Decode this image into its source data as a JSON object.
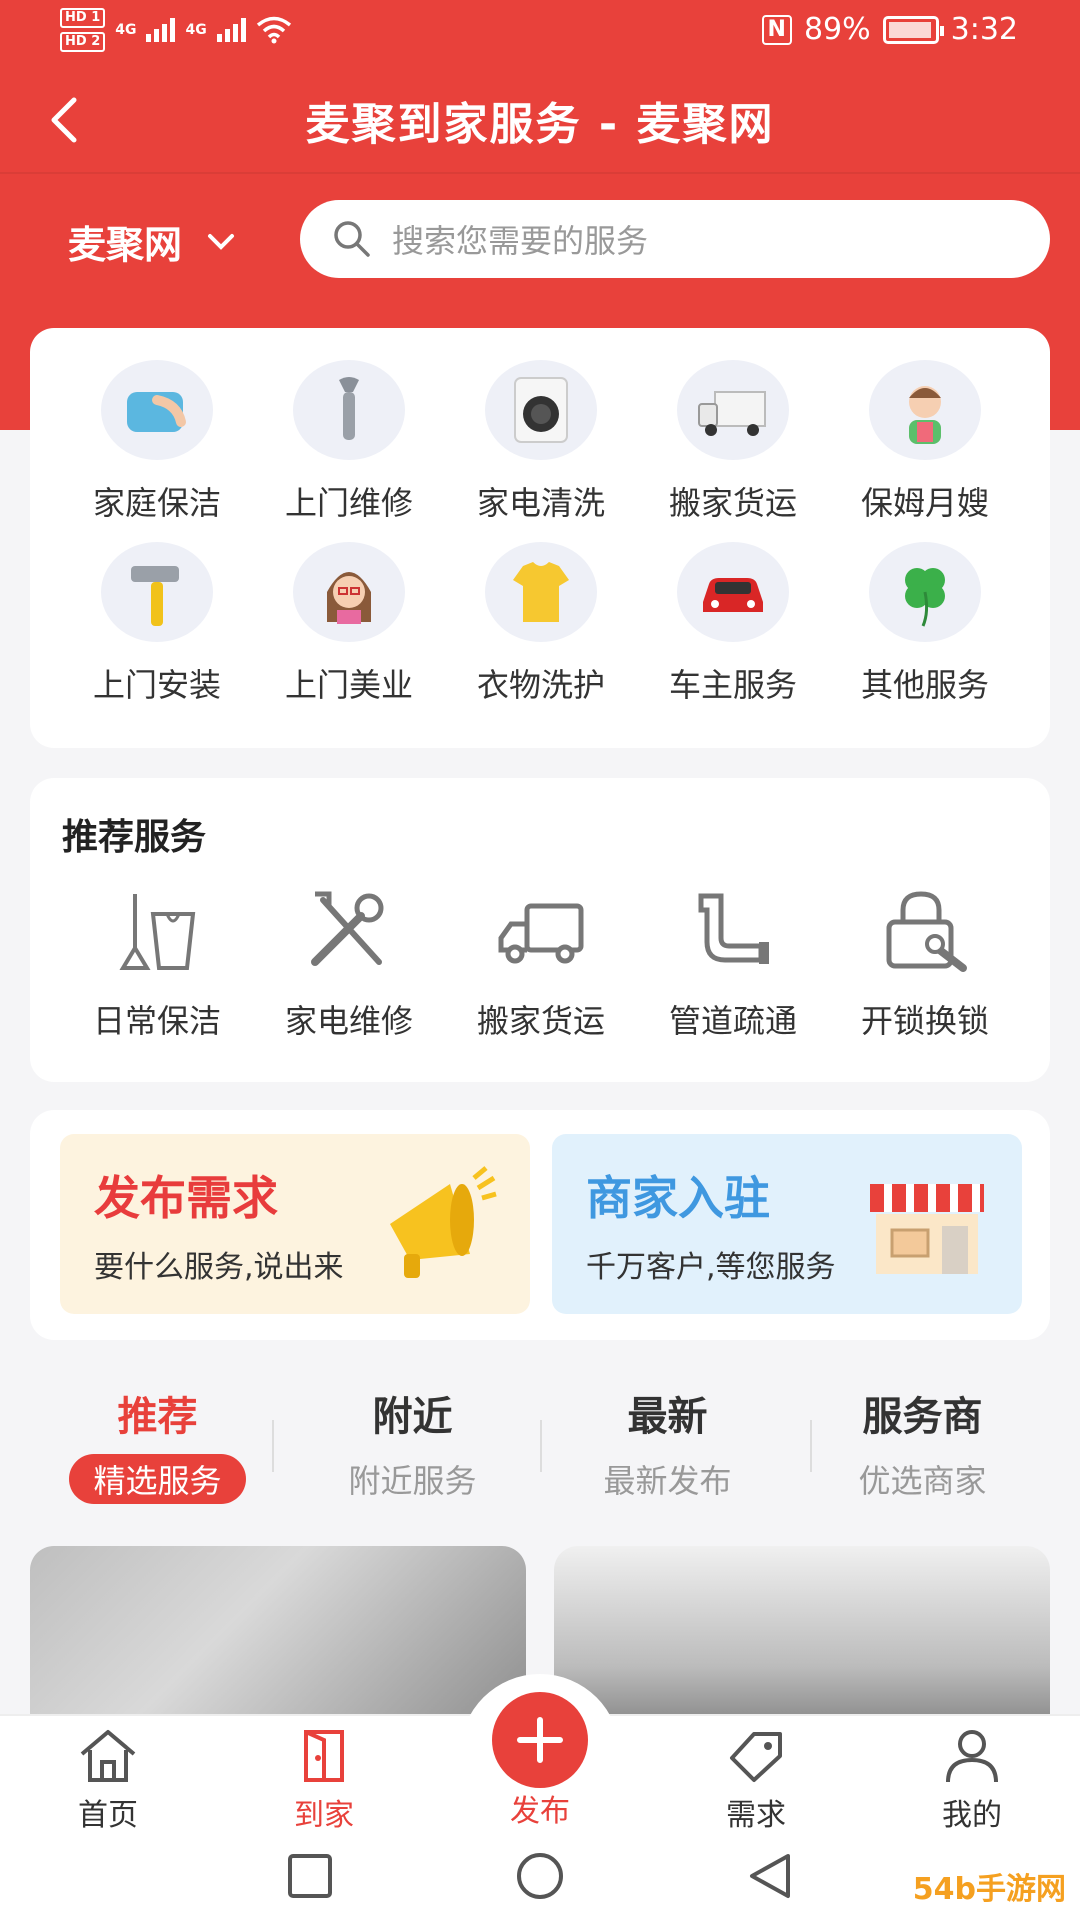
{
  "status_bar": {
    "hd1": "HD 1",
    "hd2": "HD 2",
    "net1": "4G",
    "net2": "4G",
    "nfc": "N",
    "battery": "89%",
    "time": "3:32"
  },
  "header": {
    "title": "麦聚到家服务 - 麦聚网"
  },
  "location": {
    "city": "麦聚网"
  },
  "search": {
    "placeholder": "搜索您需要的服务"
  },
  "categories": [
    {
      "label": "家庭保洁",
      "icon": "cleaning-cloth-icon"
    },
    {
      "label": "上门维修",
      "icon": "wrench-icon"
    },
    {
      "label": "家电清洗",
      "icon": "washing-machine-icon"
    },
    {
      "label": "搬家货运",
      "icon": "truck-icon"
    },
    {
      "label": "保姆月嫂",
      "icon": "nanny-icon"
    },
    {
      "label": "上门安装",
      "icon": "hammer-icon"
    },
    {
      "label": "上门美业",
      "icon": "beauty-icon"
    },
    {
      "label": "衣物洗护",
      "icon": "tshirt-icon"
    },
    {
      "label": "车主服务",
      "icon": "car-icon"
    },
    {
      "label": "其他服务",
      "icon": "clover-icon"
    }
  ],
  "recommended": {
    "title": "推荐服务",
    "items": [
      {
        "label": "日常保洁",
        "icon": "broom-bucket-icon"
      },
      {
        "label": "家电维修",
        "icon": "tools-icon"
      },
      {
        "label": "搬家货运",
        "icon": "van-icon"
      },
      {
        "label": "管道疏通",
        "icon": "pipe-icon"
      },
      {
        "label": "开锁换锁",
        "icon": "lock-wrench-icon"
      }
    ]
  },
  "promos": {
    "publish": {
      "title": "发布需求",
      "subtitle": "要什么服务,说出来"
    },
    "merchant": {
      "title": "商家入驻",
      "subtitle": "千万客户,等您服务"
    }
  },
  "tabs": [
    {
      "name": "推荐",
      "sub": "精选服务",
      "active": true
    },
    {
      "name": "附近",
      "sub": "附近服务",
      "active": false
    },
    {
      "name": "最新",
      "sub": "最新发布",
      "active": false
    },
    {
      "name": "服务商",
      "sub": "优选商家",
      "active": false
    }
  ],
  "bottom_nav": {
    "home": "首页",
    "to_home": "到家",
    "publish": "发布",
    "demand": "需求",
    "mine": "我的"
  },
  "watermark": "54b手游网",
  "colors": {
    "brand_red": "#e8413b",
    "merchant_blue": "#3f98e0"
  }
}
